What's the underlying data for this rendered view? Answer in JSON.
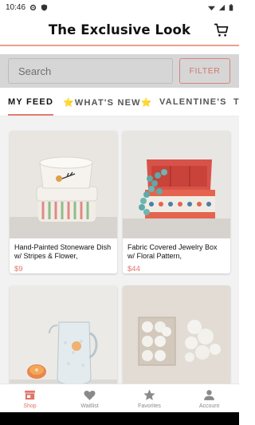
{
  "status_bar": {
    "time": "10:46"
  },
  "header": {
    "title": "The Exclusive Look"
  },
  "search": {
    "placeholder": "Search",
    "filter_label": "FILTER"
  },
  "tabs": [
    {
      "label": "MY FEED"
    },
    {
      "label": "⭐WHAT'S NEW⭐"
    },
    {
      "label": "VALENTINE'S"
    },
    {
      "label": "T"
    }
  ],
  "products": [
    {
      "name": "Hand-Painted Stoneware Dish w/ Stripes & Flower,",
      "price": "$9"
    },
    {
      "name": "Fabric Covered Jewelry Box w/ Floral Pattern,",
      "price": "$44"
    },
    {
      "name": "",
      "price": ""
    },
    {
      "name": "",
      "price": ""
    }
  ],
  "bottom_nav": [
    {
      "label": "Shop",
      "icon": "shop-icon"
    },
    {
      "label": "Waitlist",
      "icon": "heart-icon"
    },
    {
      "label": "Favorites",
      "icon": "star-icon"
    },
    {
      "label": "Account",
      "icon": "account-icon"
    }
  ],
  "colors": {
    "accent": "#e0746a",
    "search_bg": "#d6d6d6",
    "feed_bg": "#f2f2f2"
  }
}
